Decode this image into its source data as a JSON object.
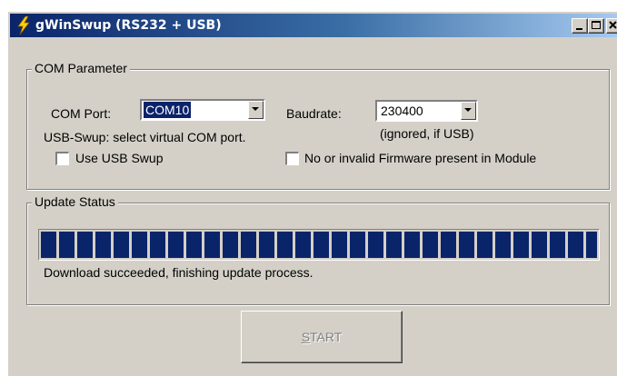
{
  "window": {
    "title": "gWinSwup (RS232 + USB)",
    "controls": {
      "minimize": "minimize-icon",
      "maximize": "maximize-icon",
      "close": "close-icon"
    }
  },
  "com_parameter": {
    "legend": "COM Parameter",
    "com_port_label": "COM Port:",
    "com_port_value": "COM10",
    "baudrate_label": "Baudrate:",
    "baudrate_value": "230400",
    "usb_hint": "USB-Swup: select virtual COM port.",
    "baud_hint": "(ignored, if USB)",
    "use_usb_label": "Use USB Swup",
    "use_usb_checked": false,
    "no_firmware_label": "No or invalid Firmware present in Module",
    "no_firmware_checked": false
  },
  "update_status": {
    "legend": "Update Status",
    "progress_fraction": 1.0,
    "status_text": "Download succeeded, finishing update process."
  },
  "start_button": {
    "mnemonic": "S",
    "rest": "TART",
    "enabled": false
  },
  "colors": {
    "progress": "#0a246a",
    "face": "#d4d0c8",
    "title_start": "#0a246a",
    "title_end": "#a6caf0"
  }
}
